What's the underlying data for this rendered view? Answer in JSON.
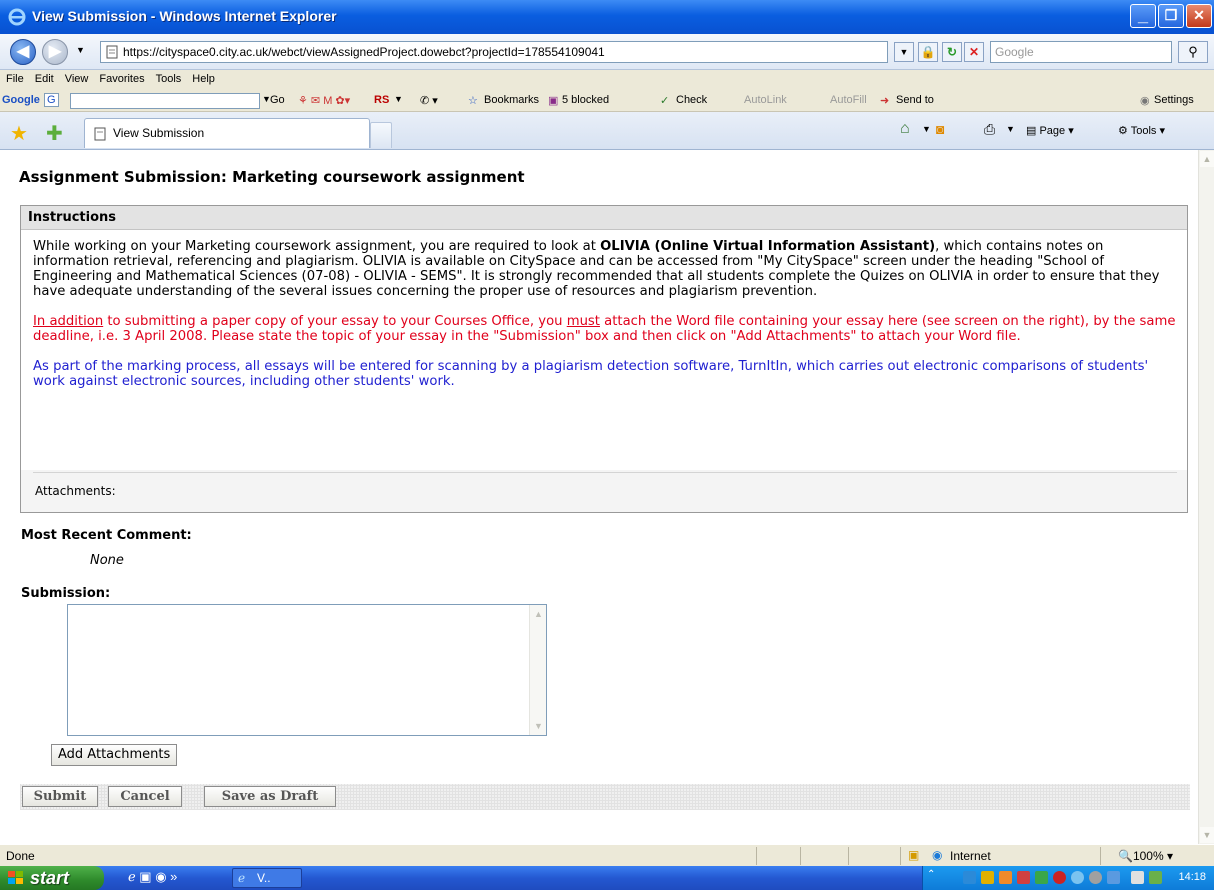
{
  "window": {
    "title": "View Submission - Windows Internet Explorer",
    "minimize": "_",
    "maximize": "❐",
    "close": "✕"
  },
  "address": {
    "url": "https://cityspace0.city.ac.uk/webct/viewAssignedProject.dowebct?projectId=178554109041",
    "search_placeholder": "Google"
  },
  "menu": [
    "File",
    "Edit",
    "View",
    "Favorites",
    "Tools",
    "Help"
  ],
  "google_toolbar": {
    "logo": "Google",
    "g_label": "G",
    "go": "Go",
    "rs": "RS",
    "bookmarks": "Bookmarks",
    "blocked": "5 blocked",
    "check": "Check",
    "autolink": "AutoLink",
    "autofill": "AutoFill",
    "send_to": "Send to",
    "settings": "Settings"
  },
  "tabs": {
    "active_tab": "View Submission",
    "page_menu": "Page",
    "tools_menu": "Tools"
  },
  "page": {
    "title": "Assignment Submission: Marketing coursework assignment",
    "instructions_header": "Instructions",
    "para1_start": "While working on your Marketing coursework assignment, you are required to look at ",
    "para1_bold": "OLIVIA (Online Virtual Information Assistant)",
    "para1_end": ", which contains notes on information retrieval, referencing and plagiarism. OLIVIA is available on CitySpace and can be accessed from \"My CitySpace\" screen under the heading \"School of Engineering and Mathematical Sciences (07-08) - OLIVIA - SEMS\". It is strongly recommended that all students complete the Quizes on OLIVIA in order to ensure that they have adequate understanding of the several issues concerning the proper use of resources and plagiarism prevention.",
    "para2_u1": "In addition",
    "para2_mid": " to submitting a paper copy of your essay to your Courses Office, you ",
    "para2_u2": "must",
    "para2_end": " attach the Word file containing your essay here (see screen on the right), by the same deadline, i.e. 3 April 2008. Please state the topic of your essay in the \"Submission\" box and then click on \"Add Attachments\" to attach your Word file.",
    "para3": "As part of the marking process, all essays will be entered for scanning by a plagiarism detection software, TurnItIn, which carries out electronic comparisons of students' work against electronic sources, including other students' work.",
    "attachments_label": "Attachments:",
    "recent_comment_label": "Most Recent Comment:",
    "recent_comment_value": "None",
    "submission_label": "Submission:",
    "submission_value": "",
    "add_attachments": "Add Attachments",
    "submit": "Submit",
    "cancel": "Cancel",
    "save_draft": "Save as Draft"
  },
  "status": {
    "text": "Done",
    "zone": "Internet",
    "zoom": "100%"
  },
  "taskbar": {
    "start": "start",
    "task": "V..",
    "clock": "14:18"
  },
  "colors": {
    "instruction_red": "#e0001b",
    "instruction_blue": "#1f1fd0",
    "titlebar_blue": "#0a5ee0",
    "start_green": "#2e8a2b"
  }
}
